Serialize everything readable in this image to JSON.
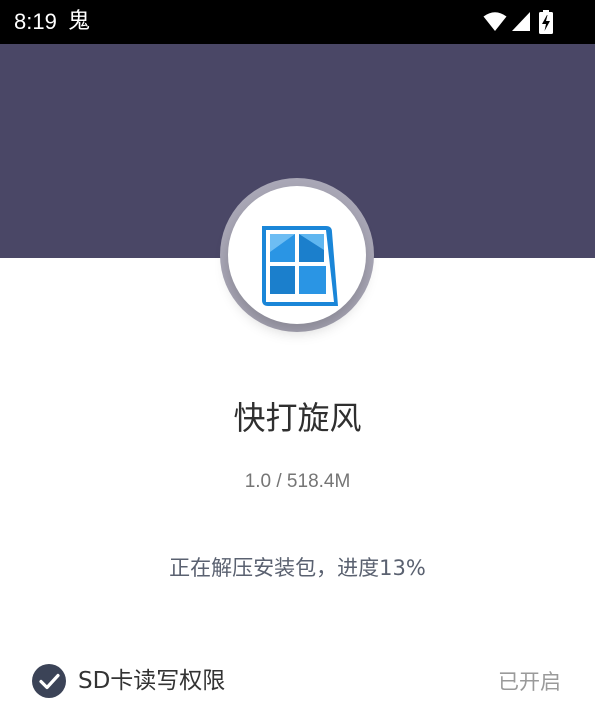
{
  "status_bar": {
    "time": "8:19",
    "notification_glyph": "鬼",
    "icons": [
      "wifi-icon",
      "signal-icon",
      "battery-charging-icon"
    ]
  },
  "app": {
    "name": "快打旋风",
    "size_info": "1.0 / 518.4M",
    "icon": "window-grid-icon"
  },
  "install": {
    "progress_text": "正在解压安装包，进度13%",
    "progress_percent": 13
  },
  "permission": {
    "label": "SD卡读写权限",
    "status": "已开启",
    "checked": true
  },
  "colors": {
    "header": "#4a4766",
    "icon_blue": "#1a86d8",
    "check_bg": "#3b4357"
  }
}
